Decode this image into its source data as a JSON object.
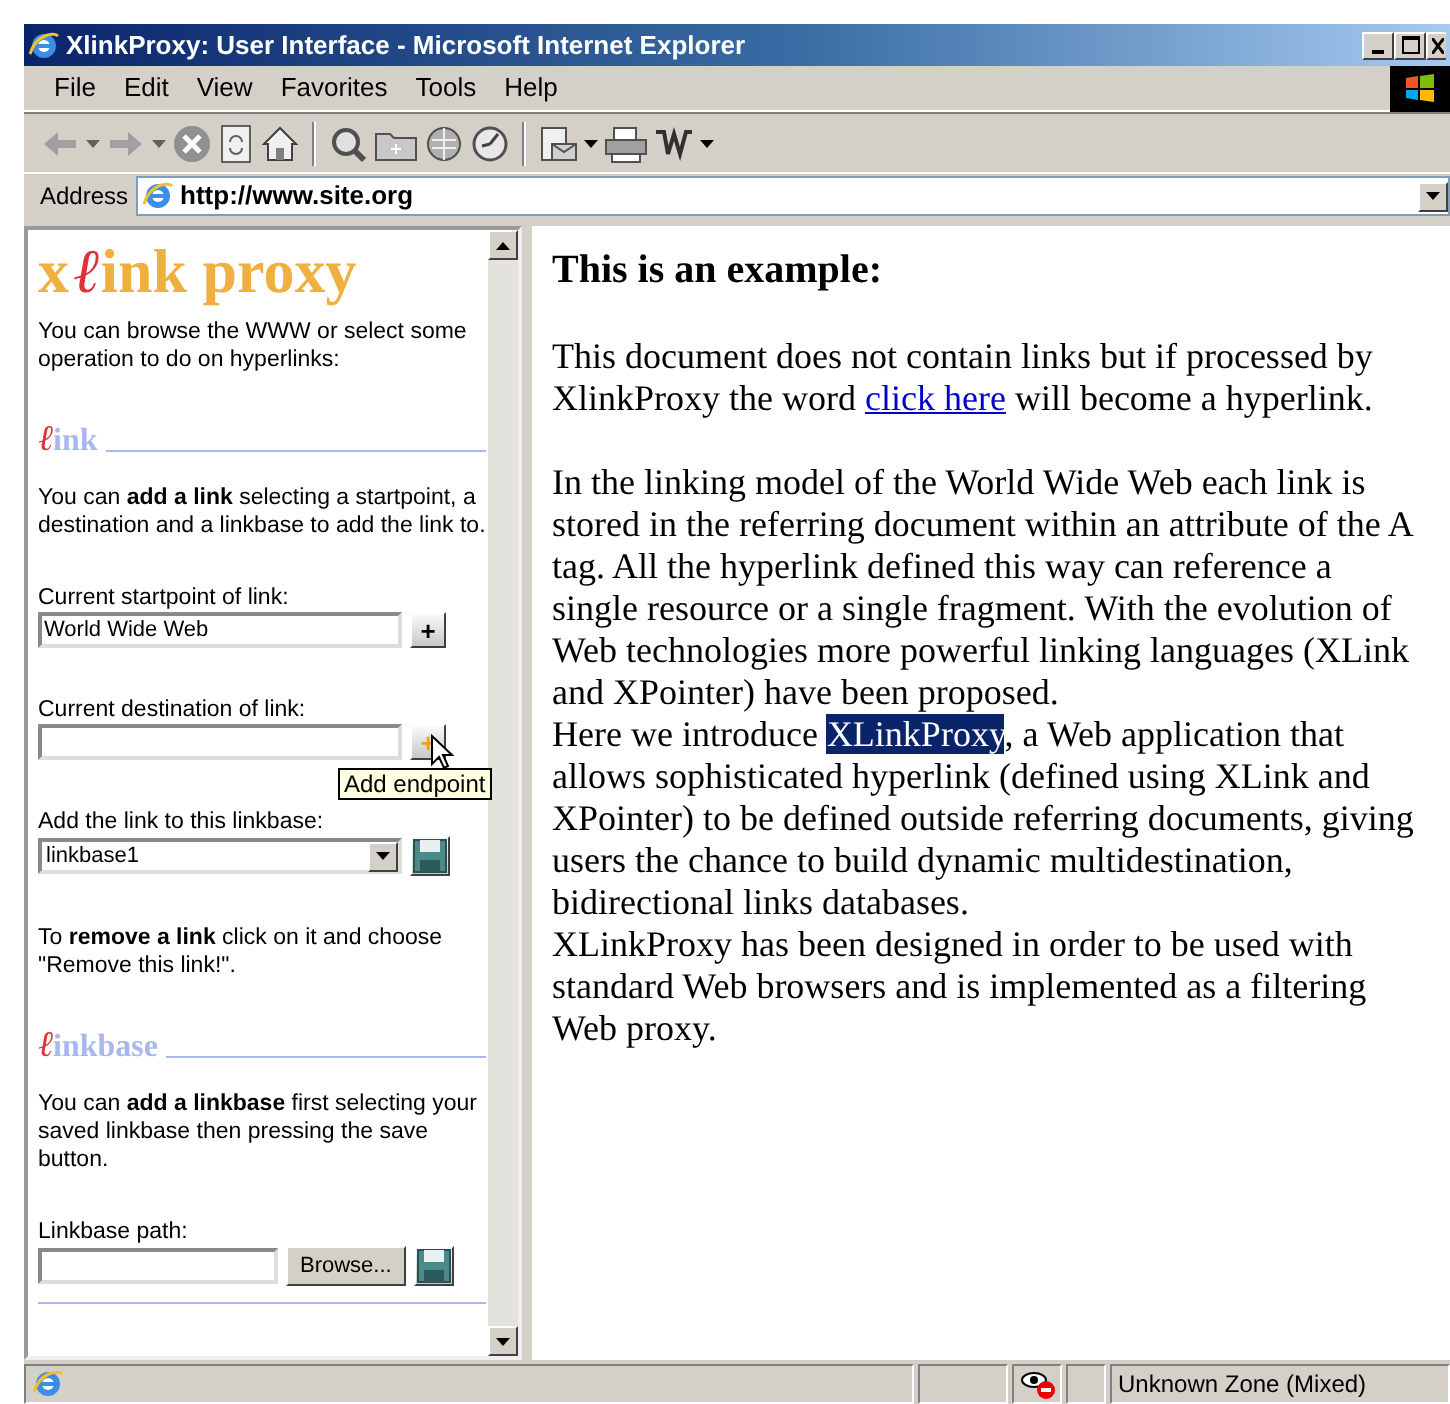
{
  "window": {
    "title": "XlinkProxy: User Interface - Microsoft Internet Explorer"
  },
  "menu": [
    "File",
    "Edit",
    "View",
    "Favorites",
    "Tools",
    "Help"
  ],
  "address": {
    "label": "Address",
    "url": "http://www.site.org"
  },
  "sidebar": {
    "blocks": [
      {
        "kind": "logo",
        "prefix": "x",
        "script": "ℓ",
        "rest": "ink proxy"
      },
      {
        "kind": "text",
        "text": "You can browse the WWW or select some operation to do on hyperlinks:"
      },
      {
        "kind": "heading",
        "script": "ℓ",
        "rest": "ink"
      },
      {
        "kind": "text",
        "text": "You can **add a link** selecting a startpoint, a destination and a linkbase to add the link to."
      },
      {
        "kind": "field",
        "label": "Current startpoint of link:",
        "value": "World Wide Web",
        "button": "+",
        "hover": false
      },
      {
        "kind": "field",
        "label": "Current destination of link:",
        "button": "+",
        "hover": true,
        "tooltip": "Add endpoint"
      },
      {
        "kind": "select",
        "label": "Add the link to this linkbase:",
        "value": "linkbase1"
      },
      {
        "kind": "text",
        "text": "To **remove a link** click on it and choose \"Remove this link!\"."
      },
      {
        "kind": "heading",
        "script": "ℓ",
        "rest": "inkbase"
      },
      {
        "kind": "text",
        "text": "You can **add a linkbase** first selecting your saved linkbase then pressing the save button."
      },
      {
        "kind": "file",
        "label": "Linkbase path:",
        "button": "Browse..."
      }
    ]
  },
  "content": {
    "heading": "This is an example:",
    "paragraphs": [
      [
        {
          "kind": "text",
          "text": "This document does not contain links but if processed by XlinkProxy the word "
        },
        {
          "kind": "link",
          "text": "click here"
        },
        {
          "kind": "text",
          "text": " will become a hyperlink."
        }
      ],
      [
        {
          "kind": "text",
          "text": "In the linking model of the World Wide Web each link is stored in the referring document within an attribute of the A tag. All the hyperlink defined this way can reference a single resource or a single fragment. With the evolution of Web technologies more powerful linking languages (XLink and XPointer) have been proposed."
        },
        {
          "kind": "break"
        },
        {
          "kind": "text",
          "text": "Here we introduce "
        },
        {
          "kind": "selection",
          "text": "XLinkProxy"
        },
        {
          "kind": "text",
          "text": ", a Web application that allows sophisticated hyperlink (defined using XLink and XPointer) to be defined outside referring documents, giving users the chance to build dynamic multidestination, bidirectional links databases."
        },
        {
          "kind": "break"
        },
        {
          "kind": "text",
          "text": "XLinkProxy has been designed in order to be used with standard Web browsers and is implemented as a filtering Web proxy."
        }
      ]
    ]
  },
  "status_bar": {
    "zone": "Unknown Zone (Mixed)"
  }
}
